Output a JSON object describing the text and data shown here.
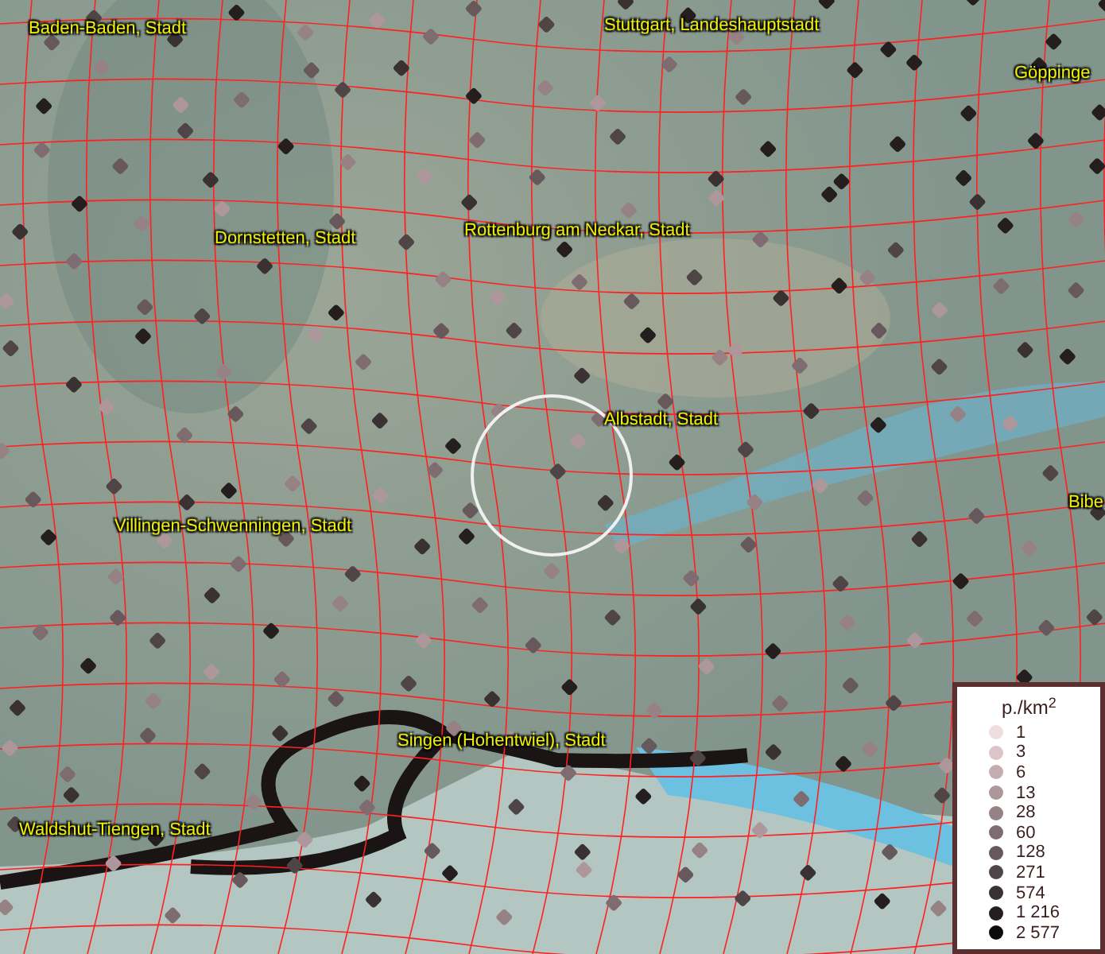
{
  "map": {
    "labels": [
      {
        "text": "Baden-Baden, Stadt"
      },
      {
        "text": "Stuttgart, Landeshauptstadt"
      },
      {
        "text": "Göppinge"
      },
      {
        "text": "Dornstetten, Stadt"
      },
      {
        "text": "Rottenburg am Neckar, Stadt"
      },
      {
        "text": "Albstadt, Stadt"
      },
      {
        "text": "Bibe"
      },
      {
        "text": "Villingen-Schwenningen, Stadt"
      },
      {
        "text": "Singen (Hohentwiel), Stadt"
      },
      {
        "text": "Waldshut-Tiengen, Stadt"
      }
    ]
  },
  "legend": {
    "title": "p./km$^{2}$",
    "items": [
      {
        "label": "1",
        "color": "#f0dde0"
      },
      {
        "label": "3",
        "color": "#dcc4c8"
      },
      {
        "label": "6",
        "color": "#c4adb1"
      },
      {
        "label": "13",
        "color": "#ad979b"
      },
      {
        "label": "28",
        "color": "#968185"
      },
      {
        "label": "60",
        "color": "#7e6c70"
      },
      {
        "label": "128",
        "color": "#66585b"
      },
      {
        "label": "271",
        "color": "#4f4446"
      },
      {
        "label": "574",
        "color": "#3a3133"
      },
      {
        "label": "1 216",
        "color": "#241e1f"
      },
      {
        "label": "2 577",
        "color": "#0d0a0b"
      }
    ]
  }
}
